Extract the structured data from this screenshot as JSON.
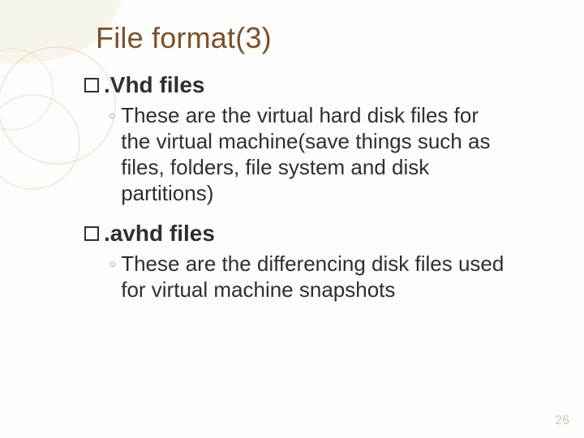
{
  "slide": {
    "title": "File format(3)",
    "pageNumber": "26",
    "items": [
      {
        "heading": ".Vhd files",
        "sub": "These are the virtual hard disk files for the virtual machine(save things such as files, folders, file system and disk partitions)"
      },
      {
        "heading": ".avhd files",
        "sub": "These are the differencing disk files used for virtual machine snapshots"
      }
    ]
  }
}
